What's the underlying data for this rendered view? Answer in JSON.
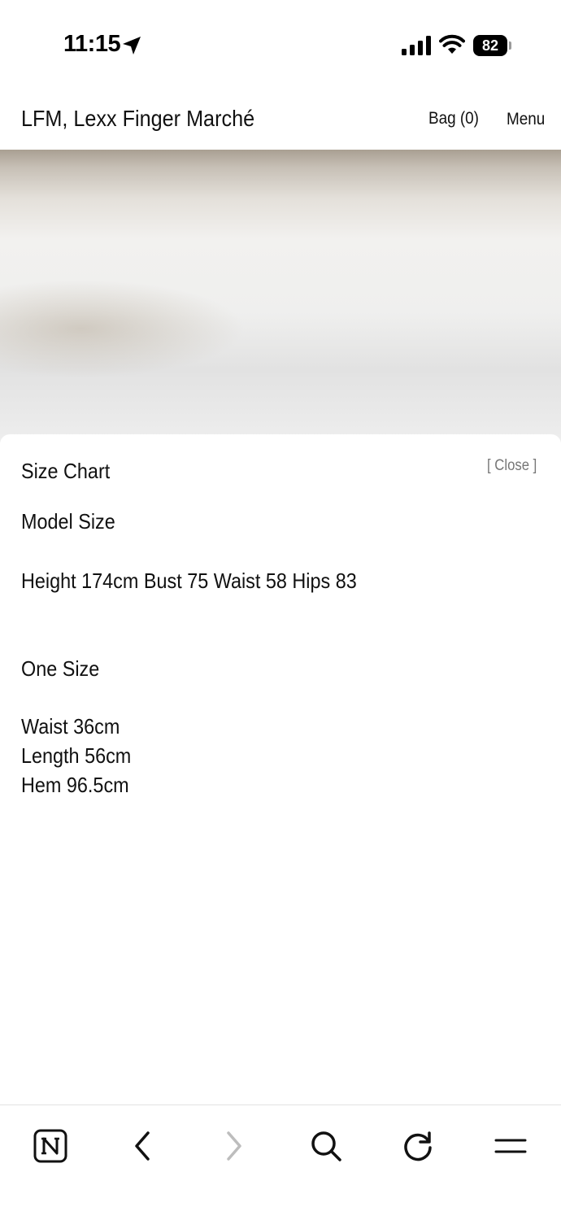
{
  "status_bar": {
    "time": "11:15",
    "battery": "82"
  },
  "header": {
    "site_title": "LFM, Lexx Finger Marché",
    "bag_label": "Bag (0)",
    "menu_label": "Menu"
  },
  "size_chart": {
    "title": "Size Chart",
    "close_label": "[ Close ]",
    "model_heading": "Model Size",
    "model_stats": "Height 174cm Bust 75 Waist 58 Hips 83",
    "size_heading": "One Size",
    "measurements": [
      "Waist 36cm",
      "Length 56cm",
      "Hem 96.5cm"
    ]
  },
  "toolbar": {
    "icons": [
      "notion-icon",
      "back-arrow-icon",
      "forward-arrow-icon",
      "search-icon",
      "reload-icon",
      "menu-icon"
    ]
  },
  "colors": {
    "text": "#111111",
    "close_text": "#777777",
    "disabled_icon": "#bdbdbd"
  }
}
